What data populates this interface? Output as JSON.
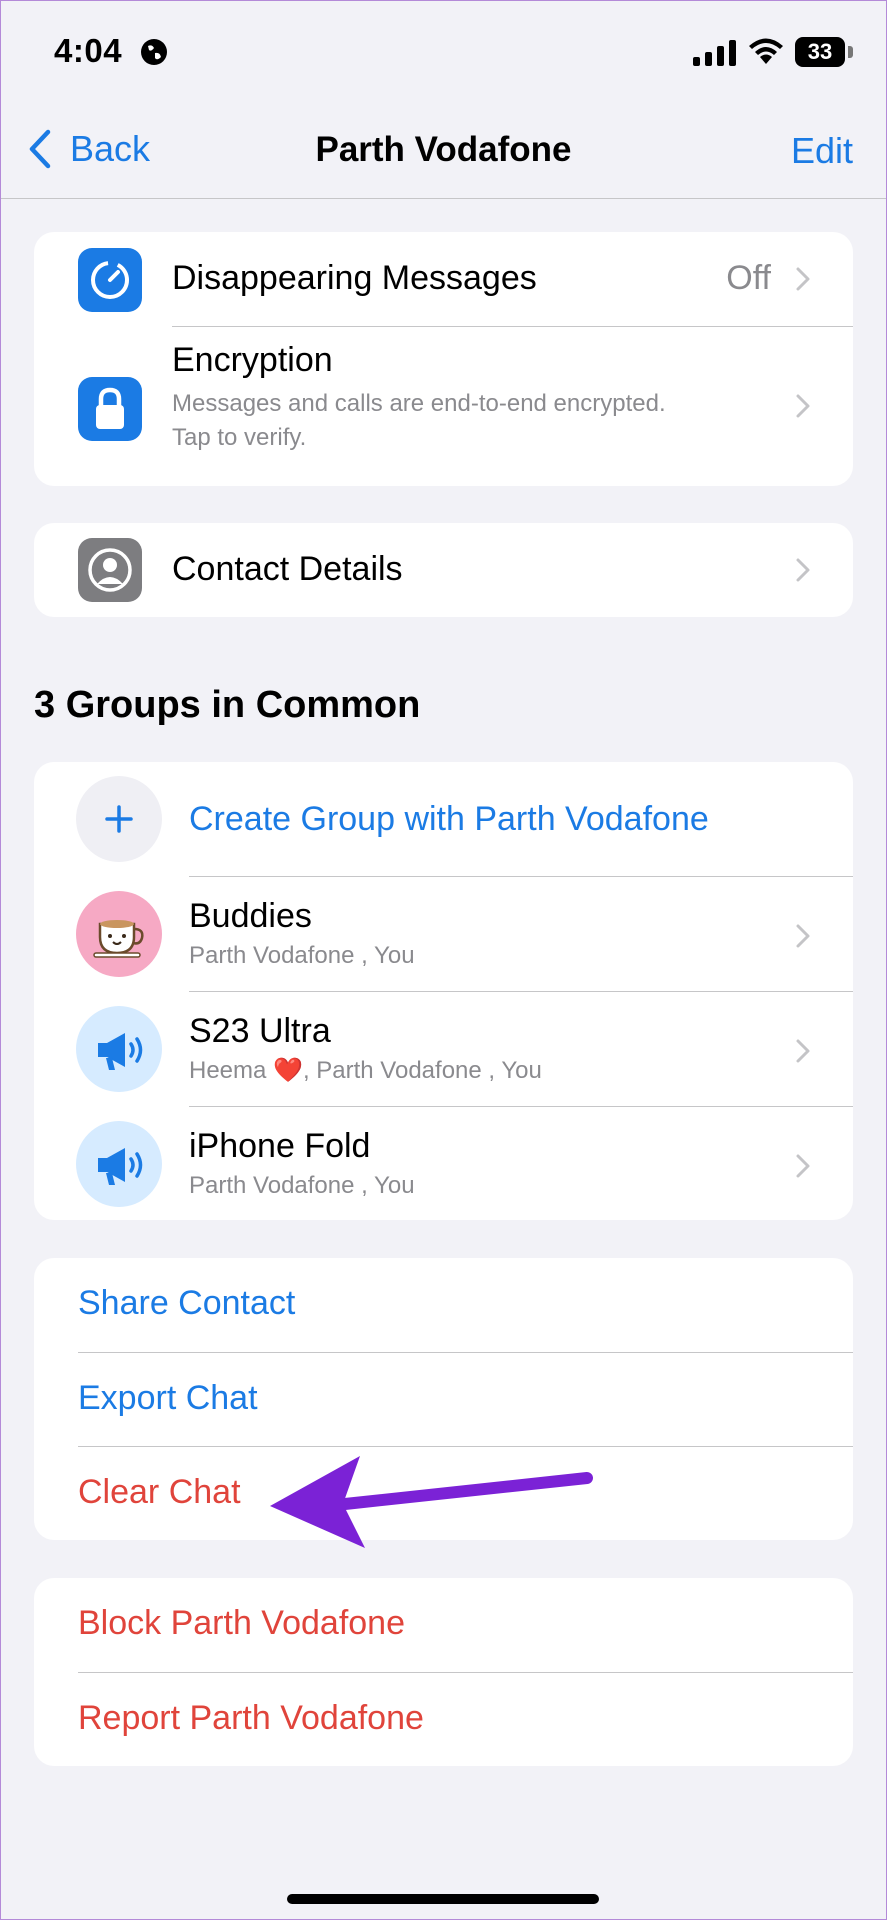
{
  "status": {
    "time": "4:04",
    "battery": "33"
  },
  "nav": {
    "back": "Back",
    "title": "Parth Vodafone",
    "edit": "Edit"
  },
  "privacy": {
    "disappearing": {
      "label": "Disappearing Messages",
      "value": "Off"
    },
    "encryption": {
      "label": "Encryption",
      "sub1": "Messages and calls are end-to-end encrypted.",
      "sub2": "Tap to verify."
    }
  },
  "contact": {
    "label": "Contact Details"
  },
  "groups": {
    "title": "3 Groups in Common",
    "create": "Create Group with Parth Vodafone",
    "items": [
      {
        "name": "Buddies",
        "members": "Parth Vodafone , You"
      },
      {
        "name": "S23 Ultra",
        "members_prefix": "Heema ",
        "members_heart": "❤️",
        "members_rest": ", Parth Vodafone , You"
      },
      {
        "name": "iPhone Fold",
        "members": "Parth Vodafone , You"
      }
    ]
  },
  "actions": {
    "share": "Share Contact",
    "export": "Export Chat",
    "clear": "Clear Chat"
  },
  "danger": {
    "block": "Block Parth Vodafone",
    "report": "Report Parth Vodafone"
  },
  "colors": {
    "accent": "#1b7be4",
    "destructive": "#e0443b",
    "annotation": "#7b22d6"
  }
}
